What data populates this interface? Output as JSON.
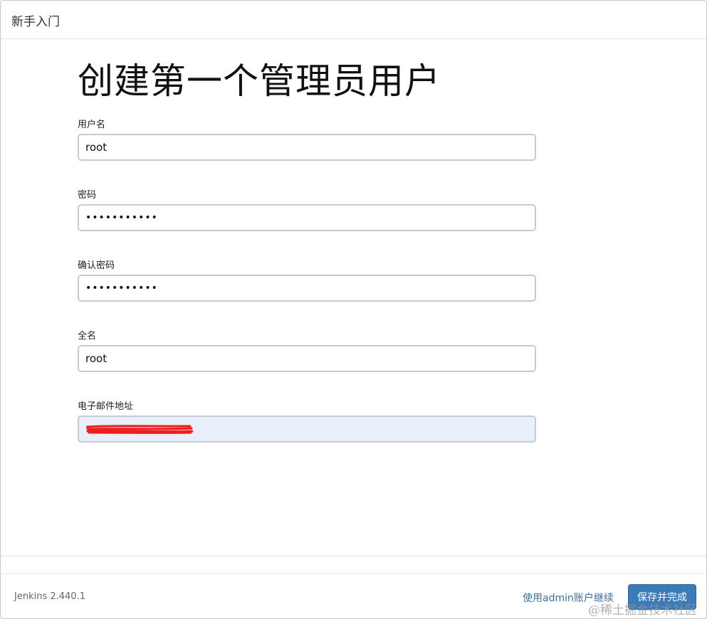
{
  "header": {
    "title": "新手入门"
  },
  "main": {
    "title": "创建第一个管理员用户",
    "fields": [
      {
        "label": "用户名",
        "value": "root",
        "type": "text"
      },
      {
        "label": "密码",
        "value": "•••••••••••",
        "type": "password"
      },
      {
        "label": "确认密码",
        "value": "•••••••••••",
        "type": "password"
      },
      {
        "label": "全名",
        "value": "root",
        "type": "text"
      },
      {
        "label": "电子邮件地址",
        "value": "",
        "type": "email",
        "redacted": true
      }
    ]
  },
  "footer": {
    "version": "Jenkins 2.440.1",
    "skip_link": "使用admin账户继续",
    "save_button": "保存并完成"
  },
  "watermark": "@稀土掘金技术社区",
  "colors": {
    "primary_button": "#3b7bb8",
    "link": "#3a6fa5",
    "input_border": "#c4cbd3",
    "autofill_background": "#e8effb",
    "redaction": "#ee1c1c"
  }
}
